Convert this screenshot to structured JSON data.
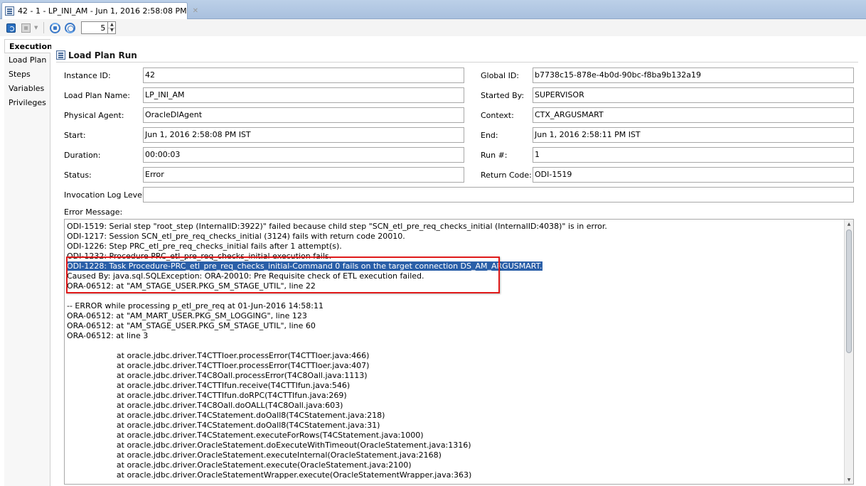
{
  "tab": {
    "title": "42 - 1 - LP_INI_AM - Jun 1, 2016 2:58:08 PM",
    "close": "✕"
  },
  "toolbar": {
    "refresh_interval": "5"
  },
  "sidenav": {
    "items": [
      "Execution",
      "Load Plan",
      "Steps",
      "Variables",
      "Privileges"
    ],
    "active": "Execution"
  },
  "section": {
    "title": "Load Plan Run"
  },
  "fields": {
    "instance_id": {
      "label": "Instance ID:",
      "value": "42"
    },
    "global_id": {
      "label": "Global ID:",
      "value": "b7738c15-878e-4b0d-90bc-f8ba9b132a19"
    },
    "load_plan_name": {
      "label": "Load Plan Name:",
      "value": "LP_INI_AM"
    },
    "started_by": {
      "label": "Started By:",
      "value": "SUPERVISOR"
    },
    "physical_agent": {
      "label": "Physical Agent:",
      "value": "OracleDIAgent"
    },
    "context": {
      "label": "Context:",
      "value": "CTX_ARGUSMART"
    },
    "start": {
      "label": "Start:",
      "value": "Jun 1, 2016 2:58:08 PM IST"
    },
    "end": {
      "label": "End:",
      "value": "Jun 1, 2016 2:58:11 PM IST"
    },
    "duration": {
      "label": "Duration:",
      "value": "00:00:03"
    },
    "run_no": {
      "label": "Run #:",
      "value": "1"
    },
    "status": {
      "label": "Status:",
      "value": "Error"
    },
    "return_code": {
      "label": "Return Code:",
      "value": "ODI-1519"
    },
    "invocation_log_level": {
      "label": "Invocation Log Level:",
      "value": ""
    }
  },
  "error": {
    "label": "Error Message:",
    "lines": [
      "ODI-1519: Serial step \"root_step (InternalID:3922)\" failed because child step \"SCN_etl_pre_req_checks_initial (InternalID:4038)\" is in error.",
      "ODI-1217: Session SCN_etl_pre_req_checks_initial (3124) fails with return code 20010.",
      "ODI-1226: Step PRC_etl_pre_req_checks_initial fails after 1 attempt(s).",
      "ODI-1232: Procedure PRC_etl_pre_req_checks_initial execution fails.",
      "ODI-1228: Task Procedure-PRC_etl_pre_req_checks_initial-Command 0 fails on the target connection DS_AM_ARGUSMART.",
      "Caused By: java.sql.SQLException: ORA-20010: Pre Requisite check of ETL execution failed.",
      "ORA-06512: at \"AM_STAGE_USER.PKG_SM_STAGE_UTIL\", line 22",
      "",
      "-- ERROR while processing p_etl_pre_req at 01-Jun-2016 14:58:11",
      "ORA-06512: at \"AM_MART_USER.PKG_SM_LOGGING\", line 123",
      "ORA-06512: at \"AM_STAGE_USER.PKG_SM_STAGE_UTIL\", line 60",
      "ORA-06512: at line 3",
      "",
      "                    at oracle.jdbc.driver.T4CTTIoer.processError(T4CTTIoer.java:466)",
      "                    at oracle.jdbc.driver.T4CTTIoer.processError(T4CTTIoer.java:407)",
      "                    at oracle.jdbc.driver.T4C8Oall.processError(T4C8Oall.java:1113)",
      "                    at oracle.jdbc.driver.T4CTTIfun.receive(T4CTTIfun.java:546)",
      "                    at oracle.jdbc.driver.T4CTTIfun.doRPC(T4CTTIfun.java:269)",
      "                    at oracle.jdbc.driver.T4C8Oall.doOALL(T4C8Oall.java:603)",
      "                    at oracle.jdbc.driver.T4CStatement.doOall8(T4CStatement.java:218)",
      "                    at oracle.jdbc.driver.T4CStatement.doOall8(T4CStatement.java:31)",
      "                    at oracle.jdbc.driver.T4CStatement.executeForRows(T4CStatement.java:1000)",
      "                    at oracle.jdbc.driver.OracleStatement.doExecuteWithTimeout(OracleStatement.java:1316)",
      "                    at oracle.jdbc.driver.OracleStatement.executeInternal(OracleStatement.java:2168)",
      "                    at oracle.jdbc.driver.OracleStatement.execute(OracleStatement.java:2100)",
      "                    at oracle.jdbc.driver.OracleStatementWrapper.execute(OracleStatementWrapper.java:363)"
    ],
    "selected_line": 4
  }
}
